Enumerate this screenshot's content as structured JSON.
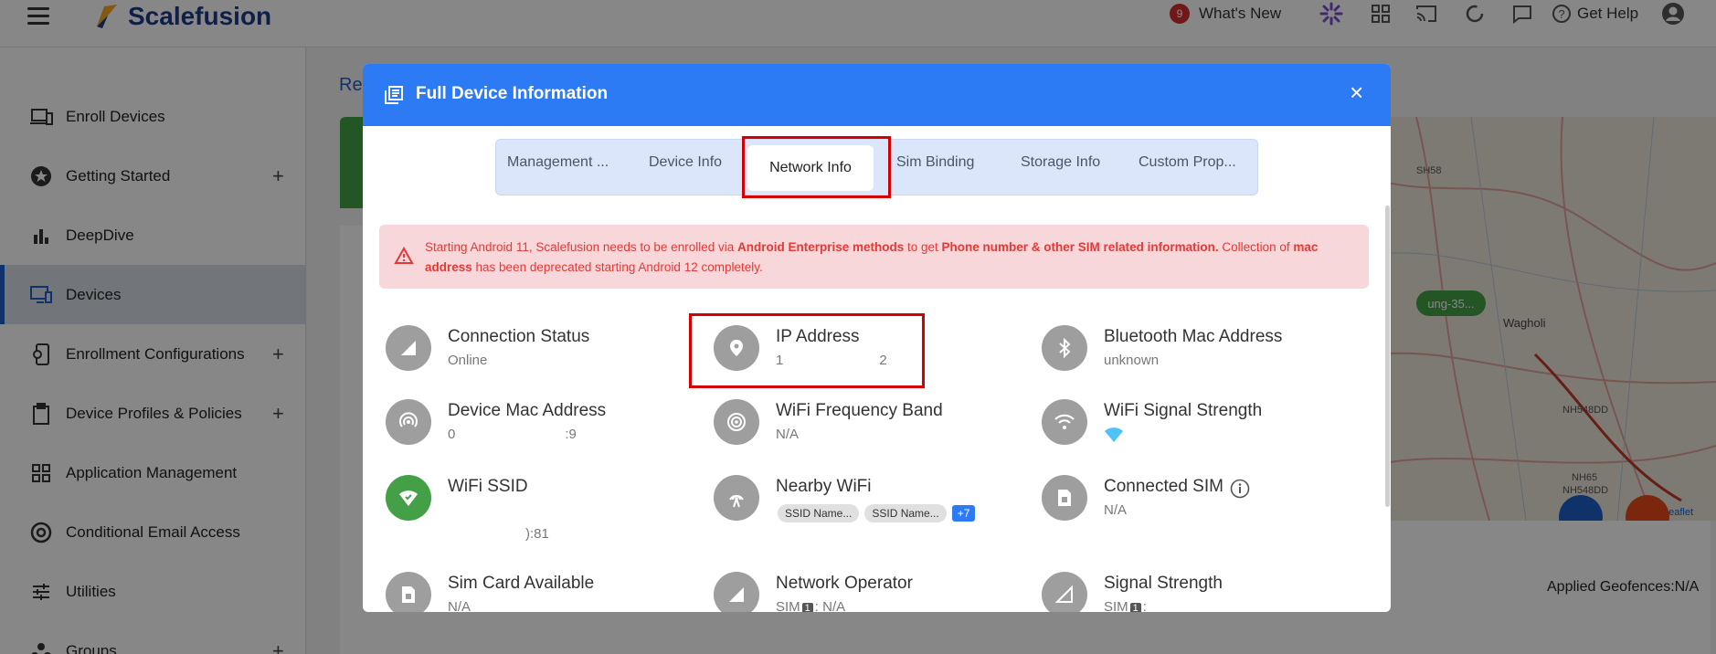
{
  "app": {
    "name": "Scalefusion"
  },
  "topbar": {
    "notif_count": "9",
    "whats_new": "What's New",
    "get_help": "Get Help"
  },
  "sidebar": {
    "items": [
      {
        "label": "Enroll Devices"
      },
      {
        "label": "Getting Started"
      },
      {
        "label": "DeepDive"
      },
      {
        "label": "Devices"
      },
      {
        "label": "Enrollment Configurations"
      },
      {
        "label": "Device Profiles & Policies"
      },
      {
        "label": "Application Management"
      },
      {
        "label": "Conditional Email Access"
      },
      {
        "label": "Utilities"
      },
      {
        "label": "Groups"
      }
    ]
  },
  "background": {
    "page_heading_fragment": "Rec",
    "applied_geofences": "Applied Geofences:N/A",
    "map_labels": [
      "SH58",
      "NH548DD",
      "NH65",
      "NH548DD",
      "Wagholi",
      "ung-35...",
      "Leaflet"
    ]
  },
  "modal": {
    "title": "Full Device Information",
    "close": "×",
    "tabs": [
      "Management ...",
      "Device Info",
      "Network Info",
      "Sim Binding",
      "Storage Info",
      "Custom Prop..."
    ],
    "alert": {
      "p1": "Starting Android 11, Scalefusion needs to be enrolled via ",
      "b1": "Android Enterprise methods",
      "p2": " to get ",
      "b2": "Phone number & other SIM related information.",
      "p3": " Collection of ",
      "b3": "mac address",
      "p4": " has been deprecated starting Android 12 completely."
    },
    "fields": {
      "connection_status": {
        "title": "Connection Status",
        "value": "Online"
      },
      "ip_address": {
        "title": "IP Address",
        "value": "1       2"
      },
      "bluetooth_mac": {
        "title": "Bluetooth Mac Address",
        "value": "unknown"
      },
      "device_mac": {
        "title": "Device Mac Address",
        "value": "0        :9"
      },
      "wifi_freq": {
        "title": "WiFi Frequency Band",
        "value": "N/A"
      },
      "wifi_signal": {
        "title": "WiFi Signal Strength"
      },
      "wifi_ssid": {
        "title": "WiFi SSID",
        "value": "):81"
      },
      "nearby_wifi": {
        "title": "Nearby WiFi",
        "chips": [
          "SSID Name...",
          "SSID Name..."
        ],
        "more": "+7"
      },
      "connected_sim": {
        "title": "Connected SIM",
        "value": "N/A"
      },
      "sim_card": {
        "title": "Sim Card Available",
        "value": "N/A"
      },
      "network_operator": {
        "title": "Network Operator",
        "sim": "SIM",
        "slot": "1",
        "value": ": N/A"
      },
      "signal_strength": {
        "title": "Signal Strength",
        "sim": "SIM",
        "slot": "1",
        "value": ":"
      }
    }
  },
  "colors": {
    "primary": "#2d7bf4",
    "alert_text": "#e53935",
    "alert_bg": "#f8d7da",
    "highlight": "#d50000"
  }
}
